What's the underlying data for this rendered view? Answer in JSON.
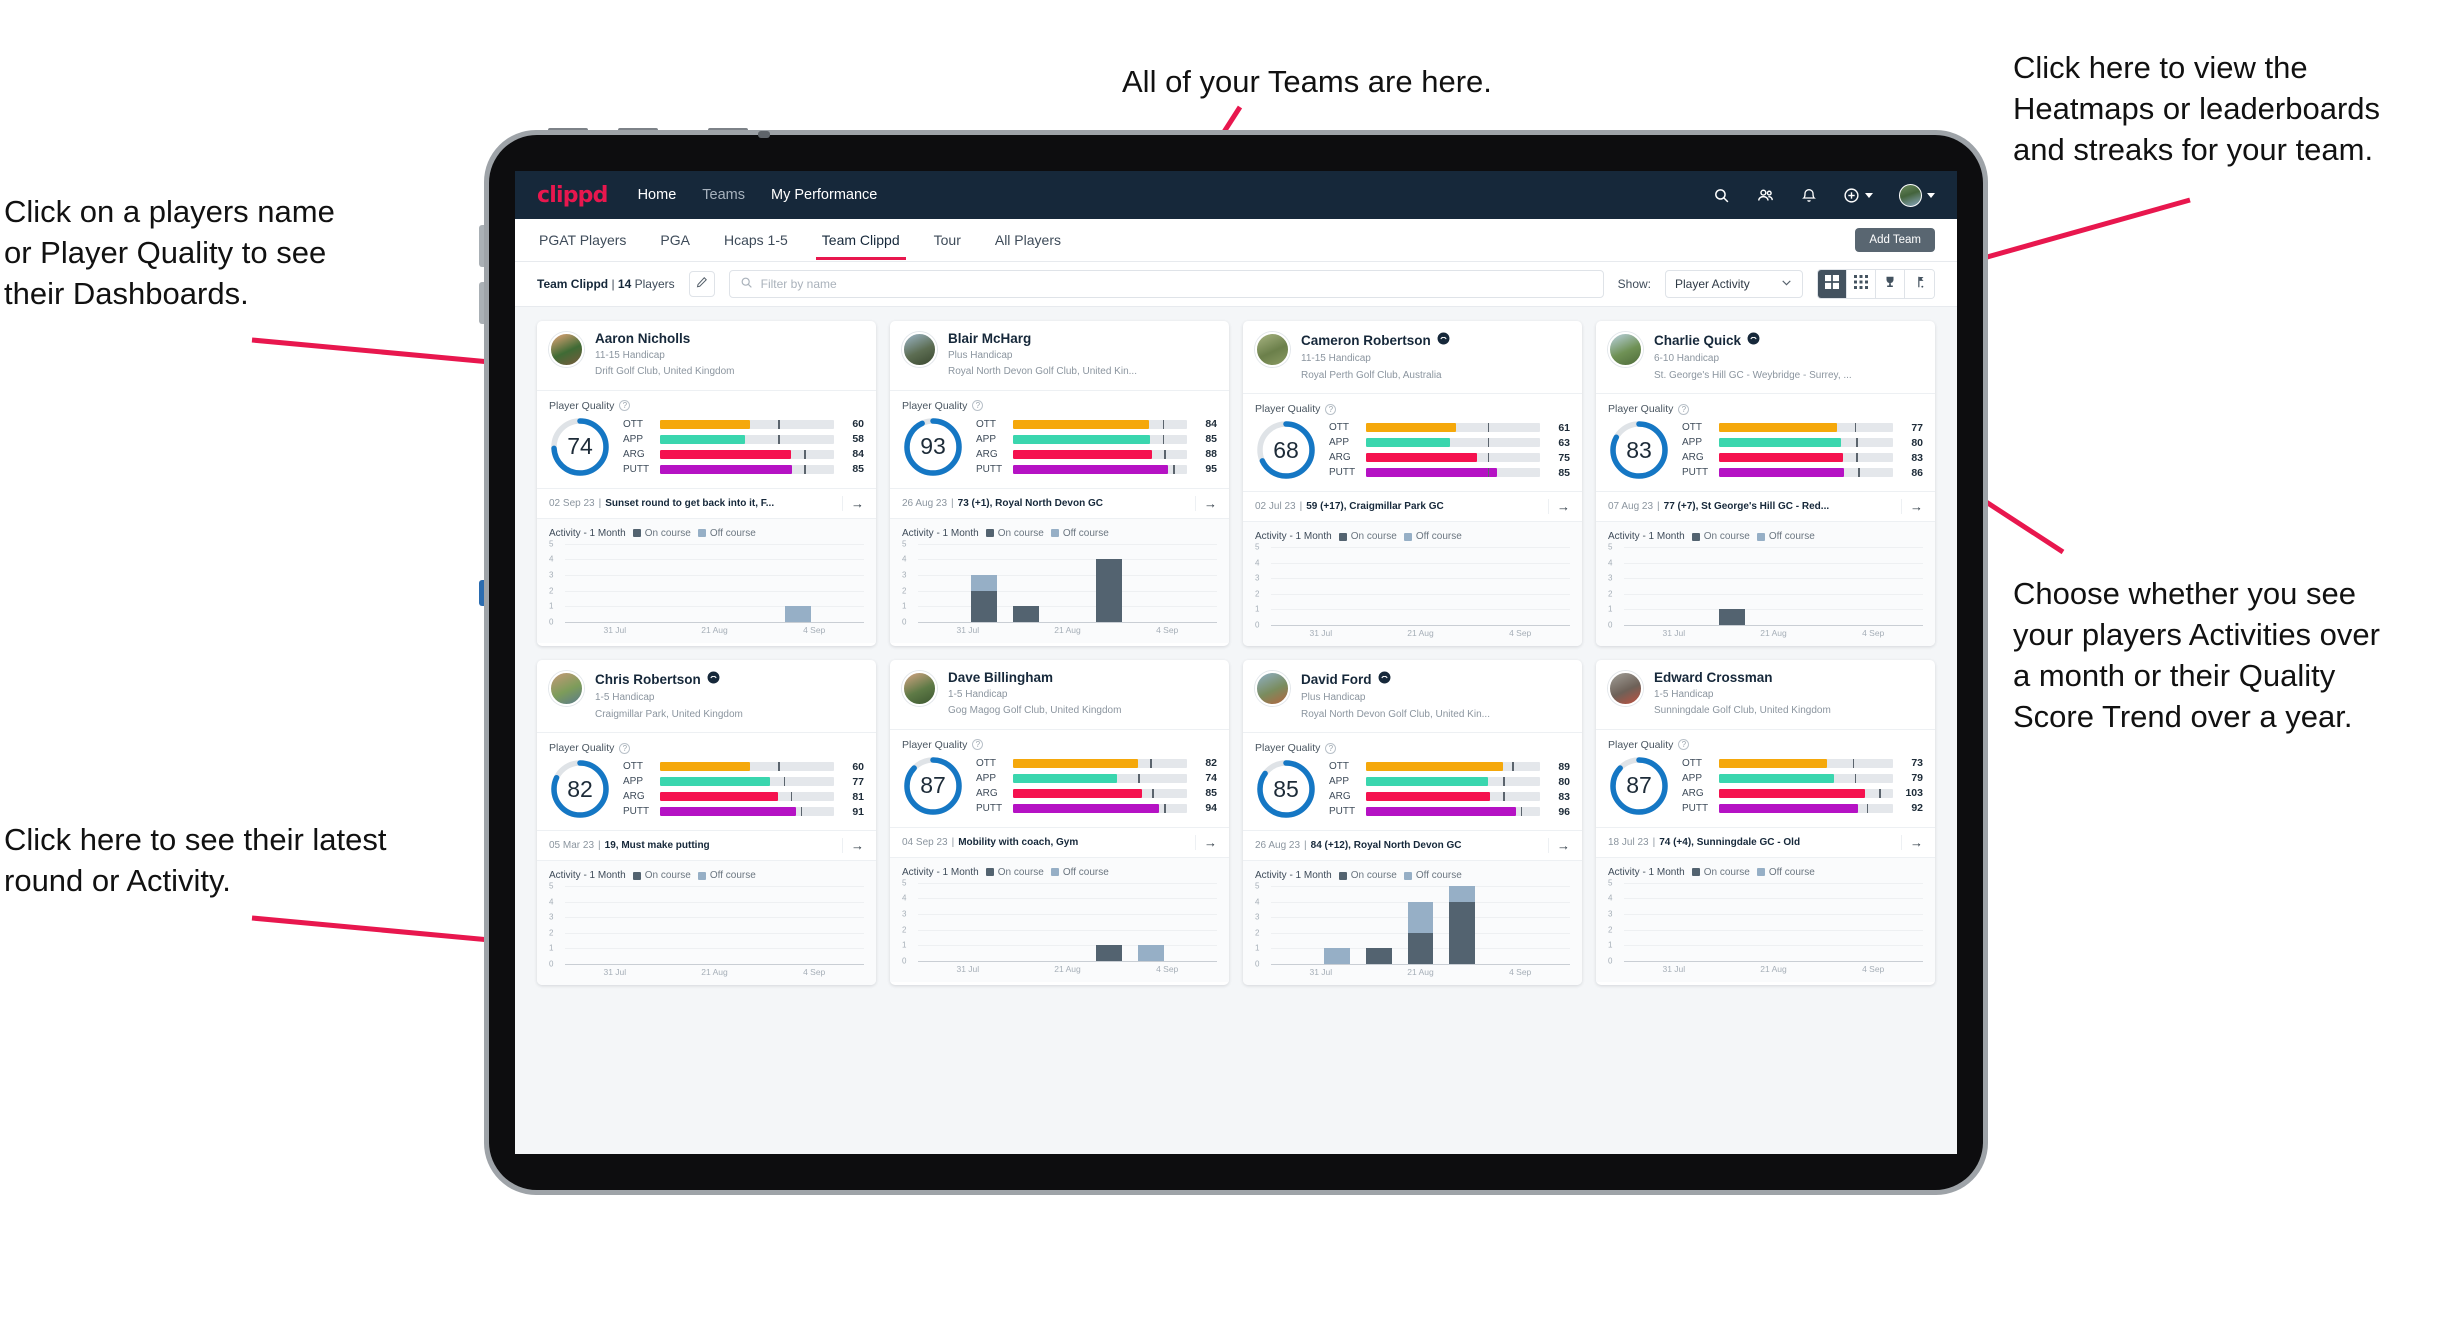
{
  "annotations": {
    "teams": "All of your Teams are here.",
    "players": "Click on a players name\nor Player Quality to see\ntheir Dashboards.",
    "heatmaps": "Click here to view the\nHeatmaps or leaderboards\nand streaks for your team.",
    "choose": "Choose whether you see\nyour players Activities over\na month or their Quality\nScore Trend over a year.",
    "latest": "Click here to see their latest\nround or Activity."
  },
  "colors": {
    "brand_pink": "#e8174e",
    "nav_dark": "#16283a",
    "ott": "#f5a80b",
    "app": "#3ad6ae",
    "arg": "#f5124f",
    "putt": "#b512c4",
    "donut_blue": "#1577c4",
    "on_course": "#536370",
    "off_course": "#96afc6"
  },
  "topnav": {
    "logo": "clippd",
    "links": [
      {
        "label": "Home",
        "active": true
      },
      {
        "label": "Teams",
        "active": false
      },
      {
        "label": "My Performance",
        "active": true
      }
    ],
    "icons": [
      "search-icon",
      "people-icon",
      "bell-icon",
      "plus-circle-icon",
      "avatar"
    ]
  },
  "tabs": [
    {
      "label": "PGAT Players",
      "active": false
    },
    {
      "label": "PGA",
      "active": false
    },
    {
      "label": "Hcaps 1-5",
      "active": false
    },
    {
      "label": "Team Clippd",
      "active": true
    },
    {
      "label": "Tour",
      "active": false
    },
    {
      "label": "All Players",
      "active": false
    }
  ],
  "add_team_label": "Add Team",
  "filterbar": {
    "team_name": "Team Clippd",
    "team_count": "14",
    "team_count_suffix": "Players",
    "edit_icon": "pencil-icon",
    "search_placeholder": "Filter by name",
    "show_label": "Show:",
    "show_value": "Player Activity",
    "view_buttons": [
      "grid-large-icon",
      "grid-small-icon",
      "trophy-icon",
      "golf-flag-icon"
    ],
    "active_view": 0
  },
  "card_labels": {
    "player_quality": "Player Quality",
    "help_icon": "help-circle-icon",
    "activity": "Activity - 1 Month",
    "on_course": "On course",
    "off_course": "Off course",
    "arrow": "→"
  },
  "chart_data": {
    "type": "bar",
    "title": "Activity - 1 Month",
    "ylabel": "",
    "xlabel": "",
    "ylim": [
      0,
      5
    ],
    "yticks": [
      0,
      1,
      2,
      3,
      4,
      5
    ],
    "xticklabels": [
      "31 Jul",
      "21 Aug",
      "4 Sep"
    ],
    "legend": [
      "On course",
      "Off course"
    ],
    "legend_position": "top",
    "grid": true,
    "series_names": [
      "On course",
      "Off course"
    ],
    "per_player": [
      {
        "player": "Aaron Nicholls",
        "on_course": [
          0,
          0,
          0,
          0,
          0,
          0,
          0
        ],
        "off_course": [
          0,
          0,
          0,
          0,
          0,
          1,
          0
        ]
      },
      {
        "player": "Blair McHarg",
        "on_course": [
          0,
          2,
          1,
          0,
          4,
          0,
          0
        ],
        "off_course": [
          0,
          1,
          0,
          0,
          0,
          0,
          0
        ]
      },
      {
        "player": "Cameron Robertson",
        "on_course": [
          0,
          0,
          0,
          0,
          0,
          0,
          0
        ],
        "off_course": [
          0,
          0,
          0,
          0,
          0,
          0,
          0
        ]
      },
      {
        "player": "Charlie Quick",
        "on_course": [
          0,
          0,
          1,
          0,
          0,
          0,
          0
        ],
        "off_course": [
          0,
          0,
          0,
          0,
          0,
          0,
          0
        ]
      },
      {
        "player": "Chris Robertson",
        "on_course": [
          0,
          0,
          0,
          0,
          0,
          0,
          0
        ],
        "off_course": [
          0,
          0,
          0,
          0,
          0,
          0,
          0
        ]
      },
      {
        "player": "Dave Billingham",
        "on_course": [
          0,
          0,
          0,
          0,
          1,
          0,
          0
        ],
        "off_course": [
          0,
          0,
          0,
          0,
          0,
          1,
          0
        ]
      },
      {
        "player": "David Ford",
        "on_course": [
          0,
          0,
          1,
          2,
          4,
          0,
          0
        ],
        "off_course": [
          0,
          1,
          0,
          2,
          1,
          0,
          0
        ]
      },
      {
        "player": "Edward Crossman",
        "on_course": [
          0,
          0,
          0,
          0,
          0,
          0,
          0
        ],
        "off_course": [
          0,
          0,
          0,
          0,
          0,
          0,
          0
        ]
      }
    ]
  },
  "players": [
    {
      "name": "Aaron Nicholls",
      "verified": false,
      "handicap": "11-15 Handicap",
      "club": "Drift Golf Club, United Kingdom",
      "avatar_colors": [
        "#e8a77a",
        "#3f6b35",
        "#7a5a3c"
      ],
      "quality": 74,
      "metrics": [
        {
          "key": "OTT",
          "value": 60,
          "fill": 52,
          "tick": 68
        },
        {
          "key": "APP",
          "value": 58,
          "fill": 49,
          "tick": 68
        },
        {
          "key": "ARG",
          "value": 84,
          "fill": 75,
          "tick": 83
        },
        {
          "key": "PUTT",
          "value": 85,
          "fill": 76,
          "tick": 83
        }
      ],
      "round_date": "02 Sep 23",
      "round_text": "Sunset round to get back into it, F..."
    },
    {
      "name": "Blair McHarg",
      "verified": false,
      "handicap": "Plus Handicap",
      "club": "Royal North Devon Golf Club, United Kin...",
      "avatar_colors": [
        "#9db7c9",
        "#5c6d52",
        "#39472f"
      ],
      "quality": 93,
      "metrics": [
        {
          "key": "OTT",
          "value": 84,
          "fill": 78,
          "tick": 86
        },
        {
          "key": "APP",
          "value": 85,
          "fill": 79,
          "tick": 86
        },
        {
          "key": "ARG",
          "value": 88,
          "fill": 80,
          "tick": 87
        },
        {
          "key": "PUTT",
          "value": 95,
          "fill": 89,
          "tick": 92
        }
      ],
      "round_date": "26 Aug 23",
      "round_text": "73 (+1), Royal North Devon GC"
    },
    {
      "name": "Cameron Robertson",
      "verified": true,
      "handicap": "11-15 Handicap",
      "club": "Royal Perth Golf Club, Australia",
      "avatar_colors": [
        "#a9b583",
        "#6b7f4a",
        "#8b9b63"
      ],
      "quality": 68,
      "metrics": [
        {
          "key": "OTT",
          "value": 61,
          "fill": 52,
          "tick": 70
        },
        {
          "key": "APP",
          "value": 63,
          "fill": 48,
          "tick": 70
        },
        {
          "key": "ARG",
          "value": 75,
          "fill": 64,
          "tick": 70
        },
        {
          "key": "PUTT",
          "value": 85,
          "fill": 75,
          "tick": 70
        }
      ],
      "round_date": "02 Jul 23",
      "round_text": "59 (+17), Craigmillar Park GC"
    },
    {
      "name": "Charlie Quick",
      "verified": true,
      "handicap": "6-10 Handicap",
      "club": "St. George's Hill GC - Weybridge - Surrey, ...",
      "avatar_colors": [
        "#bcd3e2",
        "#6f9155",
        "#4e6b3a"
      ],
      "quality": 83,
      "metrics": [
        {
          "key": "OTT",
          "value": 77,
          "fill": 68,
          "tick": 78
        },
        {
          "key": "APP",
          "value": 80,
          "fill": 70,
          "tick": 79
        },
        {
          "key": "ARG",
          "value": 83,
          "fill": 71,
          "tick": 79
        },
        {
          "key": "PUTT",
          "value": 86,
          "fill": 72,
          "tick": 80
        }
      ],
      "round_date": "07 Aug 23",
      "round_text": "77 (+7), St George's Hill GC - Red..."
    },
    {
      "name": "Chris Robertson",
      "verified": true,
      "handicap": "1-5 Handicap",
      "club": "Craigmillar Park, United Kingdom",
      "avatar_colors": [
        "#c69a78",
        "#7d9c5a",
        "#5a7a8c"
      ],
      "quality": 82,
      "metrics": [
        {
          "key": "OTT",
          "value": 60,
          "fill": 52,
          "tick": 68
        },
        {
          "key": "APP",
          "value": 77,
          "fill": 63,
          "tick": 71
        },
        {
          "key": "ARG",
          "value": 81,
          "fill": 68,
          "tick": 75
        },
        {
          "key": "PUTT",
          "value": 91,
          "fill": 78,
          "tick": 81
        }
      ],
      "round_date": "05 Mar 23",
      "round_text": "19, Must make putting"
    },
    {
      "name": "Dave Billingham",
      "verified": false,
      "handicap": "1-5 Handicap",
      "club": "Gog Magog Golf Club, United Kingdom",
      "avatar_colors": [
        "#d6a585",
        "#5e7a46",
        "#3c5630"
      ],
      "quality": 87,
      "metrics": [
        {
          "key": "OTT",
          "value": 82,
          "fill": 72,
          "tick": 79
        },
        {
          "key": "APP",
          "value": 74,
          "fill": 60,
          "tick": 72
        },
        {
          "key": "ARG",
          "value": 85,
          "fill": 74,
          "tick": 80
        },
        {
          "key": "PUTT",
          "value": 94,
          "fill": 84,
          "tick": 87
        }
      ],
      "round_date": "04 Sep 23",
      "round_text": "Mobility with coach, Gym"
    },
    {
      "name": "David Ford",
      "verified": true,
      "handicap": "Plus Handicap",
      "club": "Royal North Devon Golf Club, United Kin...",
      "avatar_colors": [
        "#8fb0c6",
        "#7a8c5e",
        "#b4643f"
      ],
      "quality": 85,
      "metrics": [
        {
          "key": "OTT",
          "value": 89,
          "fill": 79,
          "tick": 84
        },
        {
          "key": "APP",
          "value": 80,
          "fill": 70,
          "tick": 79
        },
        {
          "key": "ARG",
          "value": 83,
          "fill": 71,
          "tick": 79
        },
        {
          "key": "PUTT",
          "value": 96,
          "fill": 86,
          "tick": 89
        }
      ],
      "round_date": "26 Aug 23",
      "round_text": "84 (+12), Royal North Devon GC"
    },
    {
      "name": "Edward Crossman",
      "verified": false,
      "handicap": "1-5 Handicap",
      "club": "Sunningdale Golf Club, United Kingdom",
      "avatar_colors": [
        "#a3a099",
        "#6d6158",
        "#c0503f"
      ],
      "quality": 87,
      "metrics": [
        {
          "key": "OTT",
          "value": 73,
          "fill": 62,
          "tick": 77
        },
        {
          "key": "APP",
          "value": 79,
          "fill": 66,
          "tick": 78
        },
        {
          "key": "ARG",
          "value": 103,
          "fill": 84,
          "tick": 92
        },
        {
          "key": "PUTT",
          "value": 92,
          "fill": 80,
          "tick": 85
        }
      ],
      "round_date": "18 Jul 23",
      "round_text": "74 (+4), Sunningdale GC - Old"
    }
  ]
}
